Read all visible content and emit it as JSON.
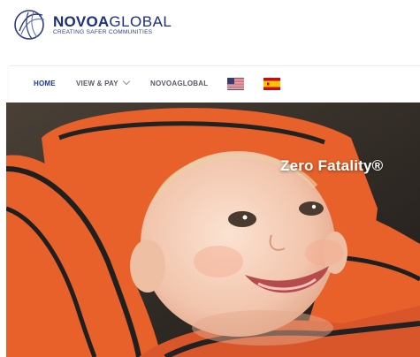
{
  "header": {
    "brand_bold": "NOVOA",
    "brand_light": "GLOBAL",
    "tagline": "CREATING SAFER COMMUNITIES",
    "logo_icon": "globe-swirl-icon"
  },
  "nav": {
    "items": [
      {
        "label": "HOME",
        "active": true
      },
      {
        "label": "VIEW & PAY",
        "has_dropdown": true
      },
      {
        "label": "NOVOAGLOBAL"
      }
    ],
    "flags": [
      {
        "icon": "us-flag-icon"
      },
      {
        "icon": "spain-flag-icon"
      }
    ]
  },
  "hero": {
    "headline": "Zero Fatality®",
    "image": "smiling baby in orange car seat"
  },
  "colors": {
    "brand_blue": "#1b2f7a",
    "nav_active": "#1a3a8f",
    "nav_text": "#555a66",
    "seat_orange": "#e8602a"
  }
}
